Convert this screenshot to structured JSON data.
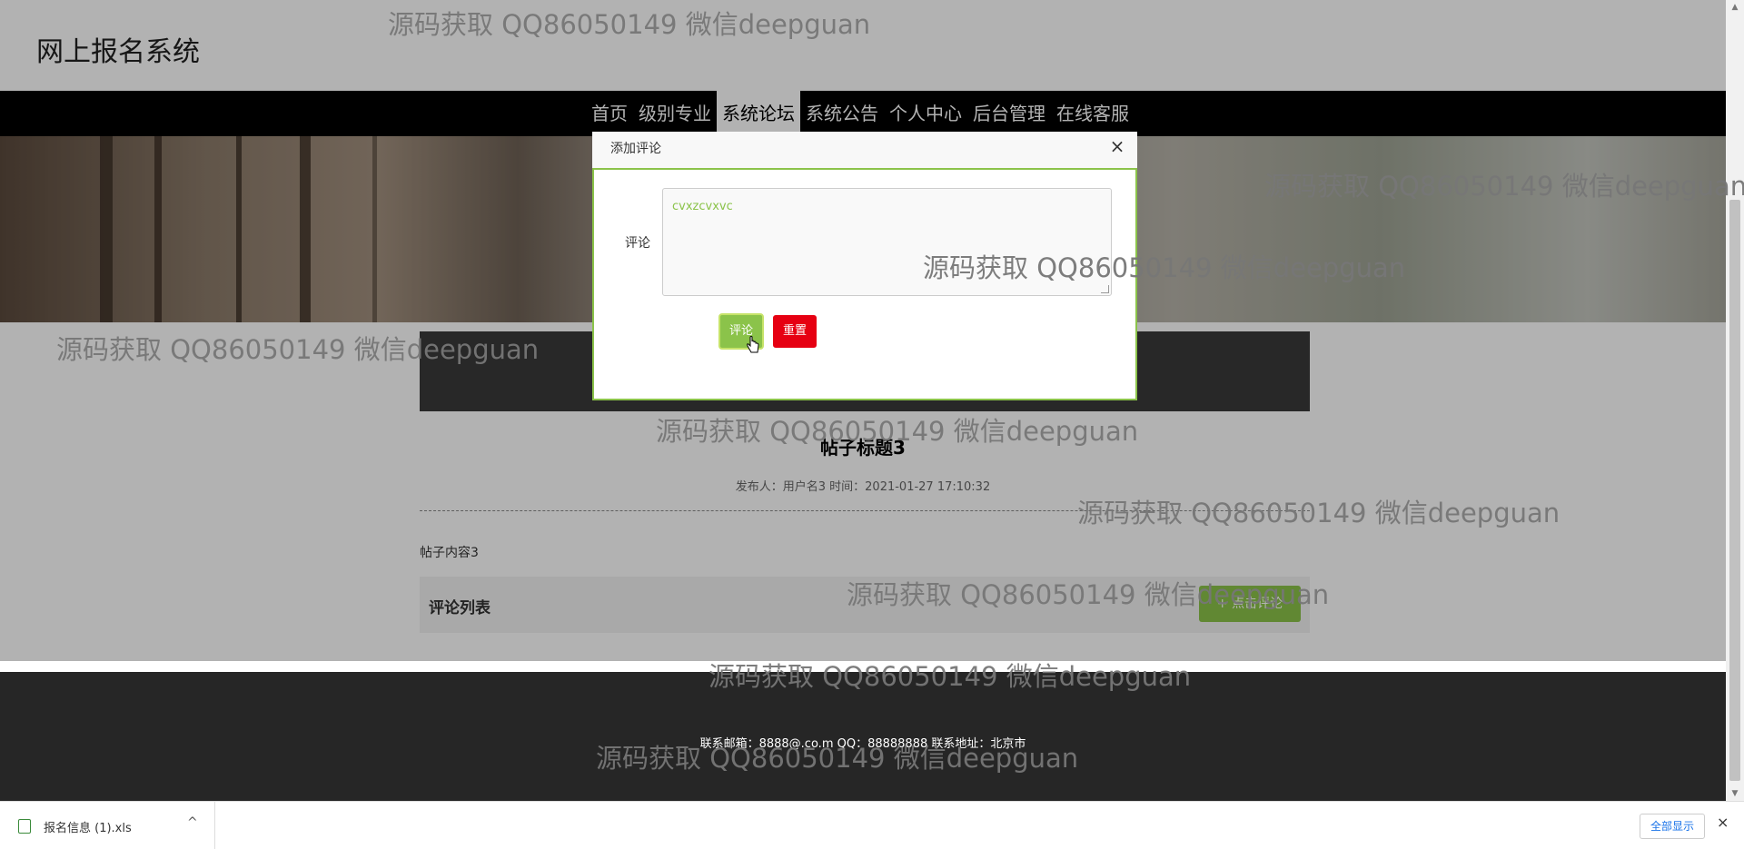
{
  "site_title": "网上报名系统",
  "nav": [
    "首页",
    "级别专业",
    "系统论坛",
    "系统公告",
    "个人中心",
    "后台管理",
    "在线客服"
  ],
  "post": {
    "title": "帖子标题3",
    "meta": "发布人：用户名3 时间：2021-01-27 17:10:32",
    "content": "帖子内容3"
  },
  "comments": {
    "heading": "评论列表",
    "add_button": "+ 点击评论"
  },
  "footer": {
    "text": "联系邮箱：8888@.co.m QQ：88888888 联系地址：北京市"
  },
  "modal": {
    "title": "添加评论",
    "close": "×",
    "field_label": "评论",
    "textarea_value": "cvxzcvxvc",
    "submit": "评论",
    "reset": "重置"
  },
  "watermark": "源码获取 QQ86050149 微信deepguan",
  "download_bar": {
    "file_name": "报名信息 (1).xls",
    "show_all": "全部显示",
    "close": "×"
  },
  "scrollbar": {
    "up": "▲",
    "down": "▼"
  },
  "colors": {
    "accent": "#8bc34a",
    "danger": "#e60012",
    "nav_bg": "#000000",
    "footer_bg": "#262626"
  }
}
